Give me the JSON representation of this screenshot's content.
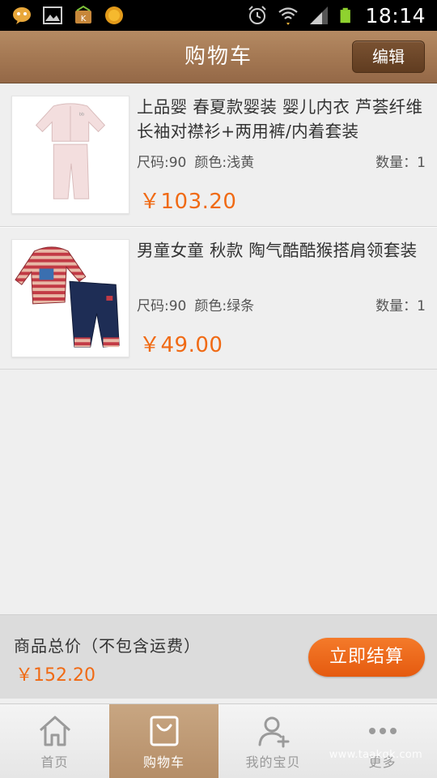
{
  "status_bar": {
    "time": "18:14",
    "icons": [
      "notification-bubble-icon",
      "gallery-icon",
      "app-notification-icon",
      "coin-icon",
      "alarm-icon",
      "wifi-icon",
      "signal-icon",
      "battery-icon"
    ]
  },
  "header": {
    "title": "购物车",
    "edit_label": "编辑"
  },
  "cart": {
    "items": [
      {
        "title": "上品婴 春夏款婴装 婴儿内衣 芦荟纤维长袖对襟衫+两用裤/内着套装",
        "size": "尺码:90",
        "color": "颜色:浅黄",
        "quantity": "数量：1",
        "price": "￥103.20"
      },
      {
        "title": "男童女童 秋款 陶气酷酷猴搭肩领套装",
        "size": "尺码:90",
        "color": "颜色:绿条",
        "quantity": "数量：1",
        "price": "￥49.00"
      }
    ]
  },
  "summary": {
    "label": "商品总价（不包含运费）",
    "total": "￥152.20",
    "checkout_label": "立即结算"
  },
  "tabs": [
    {
      "label": "首页",
      "icon": "home-icon",
      "active": false
    },
    {
      "label": "购物车",
      "icon": "cart-icon",
      "active": true
    },
    {
      "label": "我的宝贝",
      "icon": "user-add-icon",
      "active": false
    },
    {
      "label": "更多",
      "icon": "more-icon",
      "active": false
    }
  ],
  "colors": {
    "header": "#a37752",
    "price": "#f06a14",
    "checkout": "#ee6a1e",
    "active_tab": "#c4a07c"
  },
  "watermark": "www.taakqk.com"
}
